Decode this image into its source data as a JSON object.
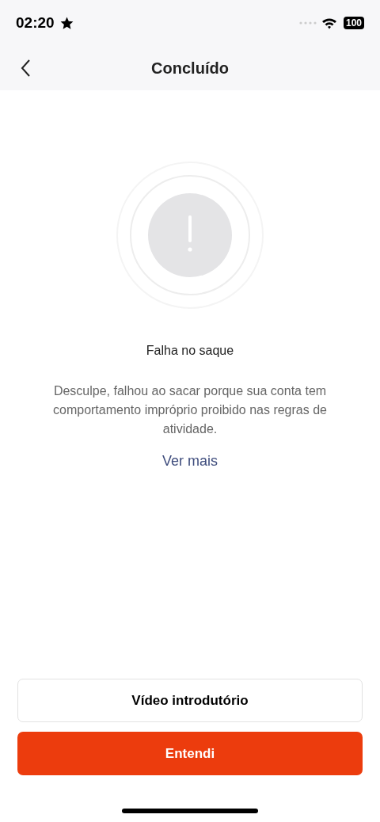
{
  "status_bar": {
    "time": "02:20",
    "battery": "100"
  },
  "nav": {
    "title": "Concluído"
  },
  "result": {
    "title": "Falha no saque",
    "message": "Desculpe, falhou ao sacar porque sua conta tem comportamento impróprio proibido nas regras de atividade.",
    "link": "Ver mais"
  },
  "buttons": [
    {
      "label": "Vídeo introdutório",
      "kind": "secondary"
    },
    {
      "label": "Entendi",
      "kind": "primary"
    }
  ]
}
